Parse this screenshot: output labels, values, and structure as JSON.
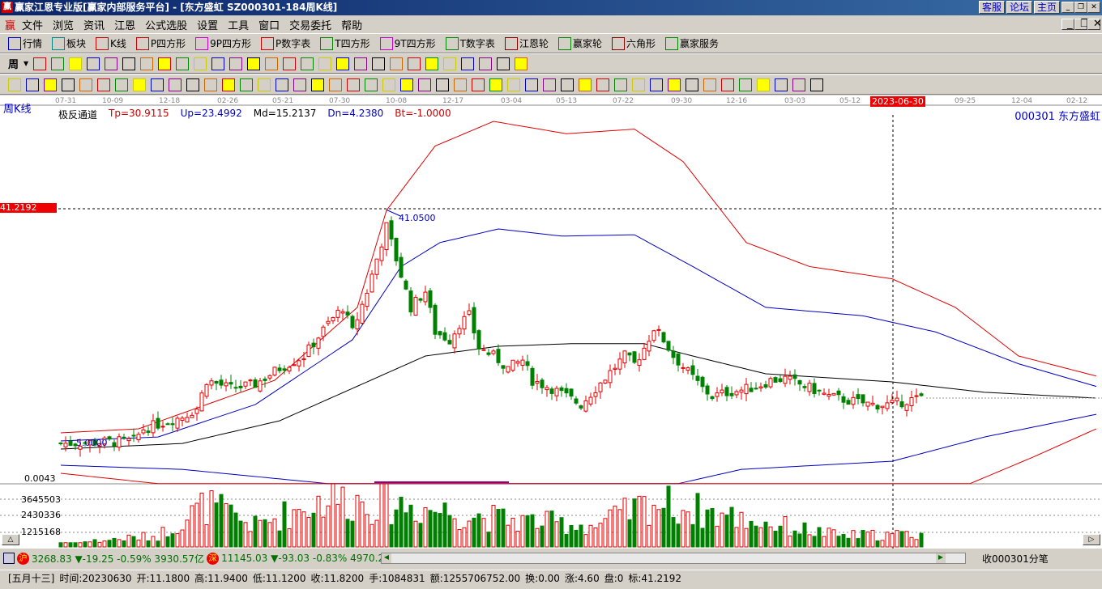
{
  "title": "赢家江恩专业版[赢家内部服务平台] - [东方盛虹   SZ000301-184周K线]",
  "title_buttons": [
    "客服",
    "论坛",
    "主页"
  ],
  "menu": [
    "文件",
    "浏览",
    "资讯",
    "江恩",
    "公式选股",
    "设置",
    "工具",
    "窗口",
    "交易委托",
    "帮助"
  ],
  "toolbar1": [
    "行情",
    "板块",
    "K线",
    "P四方形",
    "9P四方形",
    "P数字表",
    "T四方形",
    "9T四方形",
    "T数字表",
    "江恩轮",
    "赢家轮",
    "六角形",
    "赢家服务"
  ],
  "toolbar1_icons": [
    "grid-icon",
    "blocks-icon",
    "kline-icon",
    "ps-icon",
    "p9-icon",
    "pn-icon",
    "ts-icon",
    "t9-icon",
    "tn-icon",
    "gann-wheel-icon",
    "winner-wheel-icon",
    "hexagon-icon",
    "service-icon"
  ],
  "period_select": "周",
  "chart": {
    "period_label": "周K线",
    "indicator_name": "极反通道",
    "tp": "Tp=30.9115",
    "up": "Up=23.4992",
    "md": "Md=15.2137",
    "dn": "Dn=4.2380",
    "bt": "Bt=-1.0000",
    "stock": "000301  东方盛虹",
    "cursor_date": "2023-06-30",
    "cursor_price": "41.2192",
    "high_label": "41.0500",
    "low_label": "5.0000",
    "sub_value": "0.0043",
    "date_ticks": [
      "07-31",
      "10-09",
      "12-18",
      "02-26",
      "05-21",
      "07-30",
      "10-08",
      "12-17",
      "03-04",
      "05-13",
      "07-22",
      "09-30",
      "12-16",
      "03-03",
      "05-12",
      "09-25",
      "12-04",
      "02-12"
    ],
    "volume_ticks": [
      "3645503",
      "2430336",
      "1215168"
    ],
    "colors": {
      "up": "#e00000",
      "down": "#008000",
      "upper": "#e00000",
      "band": "#0000c0",
      "mid": "#000000"
    }
  },
  "chart_data": {
    "type": "candlestick",
    "x_unit": "week index",
    "close_keyframes": [
      [
        0,
        5.0
      ],
      [
        15,
        5.39
      ],
      [
        17,
        7.26
      ],
      [
        25,
        9.14
      ],
      [
        28,
        10.38
      ],
      [
        30,
        14.75
      ],
      [
        35,
        13.5
      ],
      [
        40,
        14.13
      ],
      [
        45,
        16.63
      ],
      [
        50,
        18.5
      ],
      [
        55,
        23.5
      ],
      [
        58,
        26.0
      ],
      [
        60,
        22.24
      ],
      [
        63,
        28.49
      ],
      [
        65,
        33.48
      ],
      [
        67,
        38.47
      ],
      [
        68,
        35.98
      ],
      [
        70,
        30.98
      ],
      [
        72,
        26.0
      ],
      [
        75,
        28.49
      ],
      [
        77,
        22.24
      ],
      [
        80,
        20.99
      ],
      [
        82,
        23.5
      ],
      [
        84,
        24.74
      ],
      [
        86,
        19.75
      ],
      [
        89,
        18.5
      ],
      [
        92,
        16.63
      ],
      [
        95,
        17.87
      ],
      [
        97,
        14.75
      ],
      [
        101,
        13.5
      ],
      [
        104,
        12.26
      ],
      [
        107,
        11.0
      ],
      [
        110,
        13.5
      ],
      [
        113,
        16.0
      ],
      [
        116,
        18.5
      ],
      [
        118,
        17.25
      ],
      [
        120,
        19.75
      ],
      [
        122,
        22.87
      ],
      [
        124,
        20.99
      ],
      [
        126,
        18.5
      ],
      [
        129,
        16.0
      ],
      [
        132,
        13.5
      ],
      [
        134,
        12.26
      ],
      [
        137,
        12.88
      ],
      [
        140,
        13.26
      ],
      [
        143,
        13.75
      ],
      [
        146,
        14.75
      ],
      [
        149,
        15.0
      ],
      [
        152,
        14.13
      ],
      [
        155,
        13.26
      ],
      [
        158,
        12.26
      ],
      [
        162,
        11.63
      ],
      [
        167,
        11.0
      ],
      [
        171,
        11.0
      ],
      [
        174,
        11.63
      ],
      [
        177,
        12.0
      ]
    ],
    "upper_red": [
      [
        0,
        6.64
      ],
      [
        16,
        7.26
      ],
      [
        44,
        14.75
      ],
      [
        61,
        26.0
      ],
      [
        67,
        40.97
      ],
      [
        77,
        50.9
      ],
      [
        89,
        54.7
      ],
      [
        104,
        52.8
      ],
      [
        118,
        53.5
      ],
      [
        128,
        48.5
      ],
      [
        141,
        36.0
      ],
      [
        154,
        32.3
      ],
      [
        171,
        30.4
      ],
      [
        184,
        26.0
      ],
      [
        197,
        18.5
      ],
      [
        213,
        15.4
      ]
    ],
    "upper_blue": [
      [
        0,
        5.39
      ],
      [
        20,
        6.0
      ],
      [
        40,
        11.0
      ],
      [
        60,
        21.0
      ],
      [
        70,
        32.3
      ],
      [
        78,
        36.0
      ],
      [
        90,
        38.1
      ],
      [
        103,
        37.0
      ],
      [
        118,
        37.2
      ],
      [
        130,
        32.3
      ],
      [
        145,
        26.0
      ],
      [
        165,
        24.7
      ],
      [
        180,
        22.2
      ],
      [
        197,
        17.3
      ],
      [
        213,
        13.8
      ]
    ],
    "middle": [
      [
        0,
        4.14
      ],
      [
        25,
        5.0
      ],
      [
        45,
        8.5
      ],
      [
        60,
        13.5
      ],
      [
        75,
        18.5
      ],
      [
        90,
        20.0
      ],
      [
        105,
        20.4
      ],
      [
        120,
        20.4
      ],
      [
        130,
        18.5
      ],
      [
        145,
        15.75
      ],
      [
        171,
        14.5
      ],
      [
        190,
        12.9
      ],
      [
        213,
        12.0
      ]
    ],
    "lower_blue": [
      [
        0,
        1.64
      ],
      [
        25,
        1.0
      ],
      [
        55,
        -1.2
      ],
      [
        127,
        -1.2
      ],
      [
        140,
        1.0
      ],
      [
        171,
        2.26
      ],
      [
        190,
        6.0
      ],
      [
        213,
        9.5
      ]
    ],
    "lower_red": [
      [
        0,
        0.4
      ],
      [
        20,
        -1.2
      ],
      [
        187,
        -1.2
      ],
      [
        200,
        2.9
      ],
      [
        213,
        7.26
      ]
    ],
    "price_range": [
      -1.2,
      55
    ],
    "volume_range": [
      0,
      4500000
    ]
  },
  "index_bar": {
    "sh_label": "沪",
    "sh": "3268.83 ▼-19.25 -0.59% 3930.57亿",
    "sz_label": "深",
    "sz": "11145.03 ▼-93.03 -0.83% 4970.2",
    "right": "收000301分笔"
  },
  "info": {
    "lunar": "[五月十三]",
    "time": "时间:20230630",
    "open": "开:11.1800",
    "high": "高:11.9400",
    "low": "低:11.1200",
    "close": "收:11.8200",
    "hand": "手:1084831",
    "amount": "额:1255706752.00",
    "turnover": "换:0.00",
    "rise": "涨:4.60",
    "pan": "盘:0",
    "mark": "标:41.2192"
  }
}
